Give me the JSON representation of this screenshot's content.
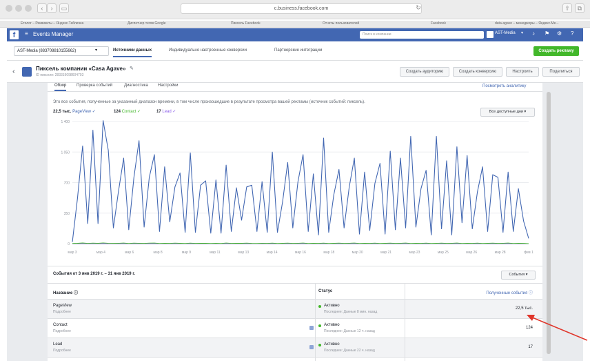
{
  "browser": {
    "url": "c.business.facebook.com",
    "bookmarks": [
      "Eтолог – Реквизиты – Яндекс.Табличка",
      "Диспетчер тегов Google",
      "Пиксель Facebook",
      "Отчеты пользователей",
      "Facebook",
      "data-agave – менеджеры – Яндекс.Ме..."
    ]
  },
  "fb_header": {
    "logo": "f",
    "title": "Events Manager",
    "search_placeholder": "Поиск в компании",
    "account": "AST-Media"
  },
  "subnav": {
    "account_select": "AST-Media (883708810155662)",
    "tabs": [
      "Источники данных",
      "Индивидуально настроенные конверсии",
      "Партнерские интеграции"
    ],
    "create_ad": "Создать рекламу"
  },
  "pixel_header": {
    "title": "Пиксель компании «Casa Agave»",
    "id_text": "ID пикселя: 283319098604703",
    "buttons": [
      "Создать аудиторию",
      "Создать конверсию",
      "Настроить",
      "Поделиться"
    ]
  },
  "content_tabs": [
    "Обзор",
    "Проверка событий",
    "Диагностика",
    "Настройки"
  ],
  "view_analytics": "Посмотреть аналитику",
  "description": "Это все события, полученные за указанный диапазон времени, в том числе произошедшие в результате просмотра вашей рекламы (источник событий: пиксель).",
  "legend": [
    {
      "value": "22,5 тыс.",
      "name": "PageView",
      "color": "#4267b2"
    },
    {
      "value": "124",
      "name": "Contact",
      "color": "#42b72a"
    },
    {
      "value": "17",
      "name": "Lead",
      "color": "#8c5eea"
    }
  ],
  "all_days": "Все доступные дни",
  "chart_data": {
    "type": "line",
    "ylim": [
      0,
      1400
    ],
    "yticks": [
      "0",
      "350",
      "700",
      "1 050",
      "1 400"
    ],
    "x_labels": [
      "мар 3",
      "мар 4",
      "мар 6",
      "мар 8",
      "мар 9",
      "мар 11",
      "мар 13",
      "мар 14",
      "мар 16",
      "мар 18",
      "мар 20",
      "мар 21",
      "мар 23",
      "мар 25",
      "мар 26",
      "мар 28",
      "фев 1"
    ],
    "series": [
      {
        "name": "PageView",
        "color": "#4267b2",
        "values": [
          20,
          520,
          1120,
          230,
          1300,
          230,
          1410,
          1070,
          180,
          600,
          980,
          160,
          760,
          1180,
          190,
          760,
          1020,
          140,
          880,
          250,
          650,
          810,
          130,
          1040,
          130,
          670,
          720,
          120,
          730,
          120,
          900,
          140,
          640,
          270,
          650,
          670,
          140,
          710,
          130,
          1050,
          130,
          480,
          930,
          180,
          710,
          1020,
          140,
          800,
          100,
          1210,
          130,
          560,
          850,
          180,
          650,
          980,
          110,
          820,
          150,
          690,
          920,
          110,
          1060,
          160,
          980,
          180,
          1230,
          190,
          630,
          840,
          100,
          1230,
          170,
          950,
          100,
          1110,
          240,
          1010,
          170,
          590,
          880,
          140,
          790,
          760,
          130,
          820,
          140,
          630,
          260,
          60
        ]
      },
      {
        "name": "Contact",
        "color": "#42b72a",
        "values": [
          2,
          4,
          8,
          3,
          6,
          4,
          9,
          5,
          3,
          5,
          7,
          2,
          6,
          5,
          3,
          6,
          7,
          2,
          5,
          3,
          6,
          4,
          2,
          6,
          3,
          5,
          4,
          2,
          5,
          2,
          7,
          3,
          5,
          4,
          6,
          3,
          2,
          5,
          3,
          6,
          2,
          4,
          6,
          3,
          5,
          7,
          2,
          5,
          3,
          6,
          2,
          4,
          6,
          3,
          5,
          7,
          2,
          5,
          3,
          6,
          2,
          4,
          6,
          3,
          5,
          7,
          2,
          5,
          3,
          6,
          2,
          4,
          6,
          3,
          5,
          7,
          2,
          5,
          3,
          6,
          2,
          4,
          6,
          3,
          5,
          7,
          2,
          5,
          3,
          1
        ]
      },
      {
        "name": "Lead",
        "color": "#8c5eea",
        "values": [
          0,
          0,
          1,
          0,
          0,
          1,
          0,
          0,
          0,
          1,
          0,
          0,
          0,
          1,
          0,
          0,
          0,
          0,
          1,
          0,
          0,
          0,
          1,
          0,
          0,
          0,
          0,
          1,
          0,
          0,
          0,
          1,
          0,
          0,
          0,
          0,
          1,
          0,
          0,
          0,
          0,
          1,
          0,
          0,
          0,
          0,
          1,
          0,
          0,
          0,
          0,
          1,
          0,
          0,
          0,
          0,
          1,
          0,
          0,
          0,
          0,
          1,
          0,
          0,
          0,
          0,
          1,
          0,
          0,
          0,
          0,
          1,
          0,
          0,
          0,
          0,
          1,
          0,
          0,
          0,
          0,
          1,
          0,
          0,
          0,
          0,
          1,
          0,
          0,
          0
        ]
      }
    ]
  },
  "events_section": {
    "title": "События от 3 янв 2019 г. – 31 янв 2019 г.",
    "events_button": "События"
  },
  "table": {
    "headers": [
      "Название",
      "Статус",
      "Полученные события"
    ],
    "rows": [
      {
        "name": "PageView",
        "sub": "Подробнее",
        "status": "Активно",
        "last": "Последнее: Данные 8 мин. назад",
        "value": "22,5 тыс."
      },
      {
        "name": "Contact",
        "sub": "Подробнее",
        "status": "Активно",
        "last": "Последнее: Данные 12 ч. назад",
        "value": "124"
      },
      {
        "name": "Lead",
        "sub": "Подробнее",
        "status": "Активно",
        "last": "Последнее: Данные 22 ч. назад",
        "value": "17"
      }
    ]
  }
}
